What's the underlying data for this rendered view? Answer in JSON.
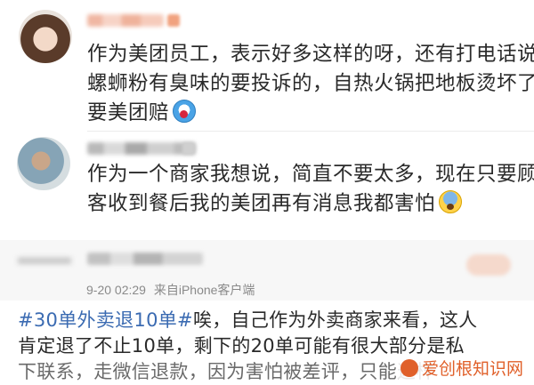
{
  "comments": [
    {
      "lines": [
        "作为美团员工，表示好多这样的呀，还有打电话说",
        "螺蛳粉有臭味的要投诉的，自热火锅把地板烫坏了",
        "要美团赔"
      ],
      "emoji": "shouting-face"
    },
    {
      "lines": [
        "作为一个商家我想说，简直不要太多，现在只要顾",
        "客收到餐后我的美团再有消息我都害怕"
      ],
      "emoji": "fearful-face"
    }
  ],
  "post": {
    "timestamp": "9-20 02:29",
    "source": "来自iPhone客户端",
    "hashtag": "#30单外卖退10单#",
    "lines": [
      "唉，自己作为外卖商家来看，这人",
      "肯定退了不止10单，剩下的20单可能有很大部分是私",
      "下联系，走微信退款，因为害怕被差评，只能这样"
    ]
  },
  "watermark": {
    "text": "爱创根知识网",
    "color": "#e0602a"
  },
  "colors": {
    "hashtag": "#3b6bb2",
    "meta": "#8a8a8a"
  }
}
